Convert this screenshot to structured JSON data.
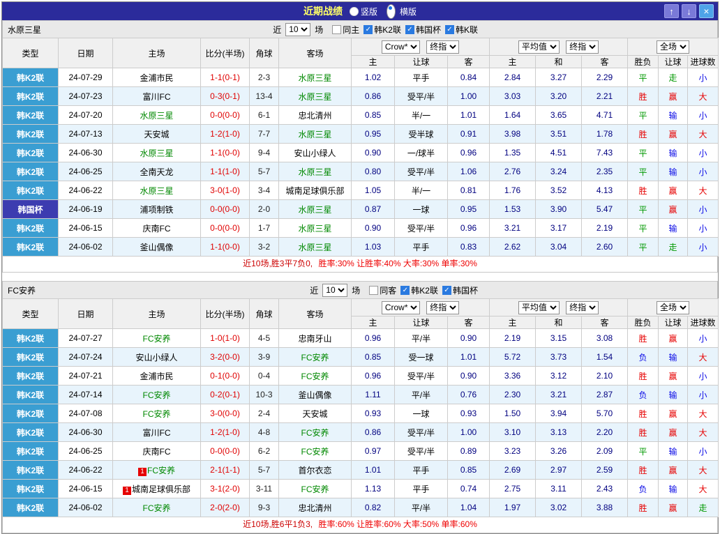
{
  "titlebar": {
    "title": "近期战绩",
    "radios": [
      {
        "label": "竖版",
        "selected": false
      },
      {
        "label": "横版",
        "selected": true
      }
    ],
    "buttons": {
      "up": "↑",
      "down": "↓",
      "close": "×"
    }
  },
  "table_headers": {
    "type": "类型",
    "date": "日期",
    "home": "主场",
    "score": "比分(半场)",
    "corner": "角球",
    "away": "客场",
    "sub": [
      "主",
      "让球",
      "客",
      "主",
      "和",
      "客",
      "胜负",
      "让球",
      "进球数"
    ]
  },
  "sections": [
    {
      "title": "水原三星",
      "filter": {
        "near": "近",
        "count": "10",
        "unit": "场",
        "checkboxes": [
          {
            "label": "同主",
            "checked": false
          },
          {
            "label": "韩K2联",
            "checked": true
          },
          {
            "label": "韩国杯",
            "checked": true
          },
          {
            "label": "韩K联",
            "checked": true
          }
        ]
      },
      "selects": {
        "g1a": "Crow*",
        "g1b": "终指",
        "g2a": "平均值",
        "g2b": "终指",
        "g3a": "全场"
      },
      "rows": [
        {
          "league": "韩K2联",
          "cup": false,
          "date": "24-07-29",
          "home": "金浦市民",
          "home_focus": false,
          "home_badge": "",
          "score": "1-1(0-1)",
          "corner": "2-3",
          "away": "水原三星",
          "away_focus": true,
          "away_badge": "",
          "ah": [
            "1.02",
            "平手",
            "0.84"
          ],
          "eu": [
            "2.84",
            "3.27",
            "2.29"
          ],
          "results": [
            {
              "t": "平",
              "c": "g"
            },
            {
              "t": "走",
              "c": "g"
            },
            {
              "t": "小",
              "c": "b"
            }
          ]
        },
        {
          "league": "韩K2联",
          "cup": false,
          "date": "24-07-23",
          "home": "富川FC",
          "home_focus": false,
          "home_badge": "",
          "score": "0-3(0-1)",
          "corner": "13-4",
          "away": "水原三星",
          "away_focus": true,
          "away_badge": "",
          "ah": [
            "0.86",
            "受平/半",
            "1.00"
          ],
          "eu": [
            "3.03",
            "3.20",
            "2.21"
          ],
          "results": [
            {
              "t": "胜",
              "c": "r"
            },
            {
              "t": "赢",
              "c": "r"
            },
            {
              "t": "大",
              "c": "r"
            }
          ]
        },
        {
          "league": "韩K2联",
          "cup": false,
          "date": "24-07-20",
          "home": "水原三星",
          "home_focus": true,
          "home_badge": "",
          "score": "0-0(0-0)",
          "corner": "6-1",
          "away": "忠北清州",
          "away_focus": false,
          "away_badge": "",
          "ah": [
            "0.85",
            "半/一",
            "1.01"
          ],
          "eu": [
            "1.64",
            "3.65",
            "4.71"
          ],
          "results": [
            {
              "t": "平",
              "c": "g"
            },
            {
              "t": "输",
              "c": "b"
            },
            {
              "t": "小",
              "c": "b"
            }
          ]
        },
        {
          "league": "韩K2联",
          "cup": false,
          "date": "24-07-13",
          "home": "天安城",
          "home_focus": false,
          "home_badge": "",
          "score": "1-2(1-0)",
          "corner": "7-7",
          "away": "水原三星",
          "away_focus": true,
          "away_badge": "",
          "ah": [
            "0.95",
            "受半球",
            "0.91"
          ],
          "eu": [
            "3.98",
            "3.51",
            "1.78"
          ],
          "results": [
            {
              "t": "胜",
              "c": "r"
            },
            {
              "t": "赢",
              "c": "r"
            },
            {
              "t": "大",
              "c": "r"
            }
          ]
        },
        {
          "league": "韩K2联",
          "cup": false,
          "date": "24-06-30",
          "home": "水原三星",
          "home_focus": true,
          "home_badge": "",
          "score": "1-1(0-0)",
          "corner": "9-4",
          "away": "安山小绿人",
          "away_focus": false,
          "away_badge": "",
          "ah": [
            "0.90",
            "一/球半",
            "0.96"
          ],
          "eu": [
            "1.35",
            "4.51",
            "7.43"
          ],
          "results": [
            {
              "t": "平",
              "c": "g"
            },
            {
              "t": "输",
              "c": "b"
            },
            {
              "t": "小",
              "c": "b"
            }
          ]
        },
        {
          "league": "韩K2联",
          "cup": false,
          "date": "24-06-25",
          "home": "全南天龙",
          "home_focus": false,
          "home_badge": "",
          "score": "1-1(1-0)",
          "corner": "5-7",
          "away": "水原三星",
          "away_focus": true,
          "away_badge": "",
          "ah": [
            "0.80",
            "受平/半",
            "1.06"
          ],
          "eu": [
            "2.76",
            "3.24",
            "2.35"
          ],
          "results": [
            {
              "t": "平",
              "c": "g"
            },
            {
              "t": "输",
              "c": "b"
            },
            {
              "t": "小",
              "c": "b"
            }
          ]
        },
        {
          "league": "韩K2联",
          "cup": false,
          "date": "24-06-22",
          "home": "水原三星",
          "home_focus": true,
          "home_badge": "",
          "score": "3-0(1-0)",
          "corner": "3-4",
          "away": "城南足球俱乐部",
          "away_focus": false,
          "away_badge": "",
          "ah": [
            "1.05",
            "半/一",
            "0.81"
          ],
          "eu": [
            "1.76",
            "3.52",
            "4.13"
          ],
          "results": [
            {
              "t": "胜",
              "c": "r"
            },
            {
              "t": "赢",
              "c": "r"
            },
            {
              "t": "大",
              "c": "r"
            }
          ]
        },
        {
          "league": "韩国杯",
          "cup": true,
          "date": "24-06-19",
          "home": "浦项制铁",
          "home_focus": false,
          "home_badge": "",
          "score": "0-0(0-0)",
          "corner": "2-0",
          "away": "水原三星",
          "away_focus": true,
          "away_badge": "",
          "ah": [
            "0.87",
            "一球",
            "0.95"
          ],
          "eu": [
            "1.53",
            "3.90",
            "5.47"
          ],
          "results": [
            {
              "t": "平",
              "c": "g"
            },
            {
              "t": "赢",
              "c": "r"
            },
            {
              "t": "小",
              "c": "b"
            }
          ]
        },
        {
          "league": "韩K2联",
          "cup": false,
          "date": "24-06-15",
          "home": "庆南FC",
          "home_focus": false,
          "home_badge": "",
          "score": "0-0(0-0)",
          "corner": "1-7",
          "away": "水原三星",
          "away_focus": true,
          "away_badge": "",
          "ah": [
            "0.90",
            "受平/半",
            "0.96"
          ],
          "eu": [
            "3.21",
            "3.17",
            "2.19"
          ],
          "results": [
            {
              "t": "平",
              "c": "g"
            },
            {
              "t": "输",
              "c": "b"
            },
            {
              "t": "小",
              "c": "b"
            }
          ]
        },
        {
          "league": "韩K2联",
          "cup": false,
          "date": "24-06-02",
          "home": "釜山偶像",
          "home_focus": false,
          "home_badge": "",
          "score": "1-1(0-0)",
          "corner": "3-2",
          "away": "水原三星",
          "away_focus": true,
          "away_badge": "",
          "ah": [
            "1.03",
            "平手",
            "0.83"
          ],
          "eu": [
            "2.62",
            "3.04",
            "2.60"
          ],
          "results": [
            {
              "t": "平",
              "c": "g"
            },
            {
              "t": "走",
              "c": "g"
            },
            {
              "t": "小",
              "c": "b"
            }
          ]
        }
      ],
      "summary": {
        "record": "近10场,胜3平7负0,",
        "stats": "胜率:30% 让胜率:40% 大率:30% 单率:30%"
      }
    },
    {
      "title": "FC安养",
      "filter": {
        "near": "近",
        "count": "10",
        "unit": "场",
        "checkboxes": [
          {
            "label": "同客",
            "checked": false
          },
          {
            "label": "韩K2联",
            "checked": true
          },
          {
            "label": "韩国杯",
            "checked": true
          }
        ]
      },
      "selects": {
        "g1a": "Crow*",
        "g1b": "终指",
        "g2a": "平均值",
        "g2b": "终指",
        "g3a": "全场"
      },
      "rows": [
        {
          "league": "韩K2联",
          "cup": false,
          "date": "24-07-27",
          "home": "FC安养",
          "home_focus": true,
          "home_badge": "",
          "score": "1-0(1-0)",
          "corner": "4-5",
          "away": "忠南牙山",
          "away_focus": false,
          "away_badge": "",
          "ah": [
            "0.96",
            "平/半",
            "0.90"
          ],
          "eu": [
            "2.19",
            "3.15",
            "3.08"
          ],
          "results": [
            {
              "t": "胜",
              "c": "r"
            },
            {
              "t": "赢",
              "c": "r"
            },
            {
              "t": "小",
              "c": "b"
            }
          ]
        },
        {
          "league": "韩K2联",
          "cup": false,
          "date": "24-07-24",
          "home": "安山小绿人",
          "home_focus": false,
          "home_badge": "",
          "score": "3-2(0-0)",
          "corner": "3-9",
          "away": "FC安养",
          "away_focus": true,
          "away_badge": "",
          "ah": [
            "0.85",
            "受一球",
            "1.01"
          ],
          "eu": [
            "5.72",
            "3.73",
            "1.54"
          ],
          "results": [
            {
              "t": "负",
              "c": "b"
            },
            {
              "t": "输",
              "c": "b"
            },
            {
              "t": "大",
              "c": "r"
            }
          ]
        },
        {
          "league": "韩K2联",
          "cup": false,
          "date": "24-07-21",
          "home": "金浦市民",
          "home_focus": false,
          "home_badge": "",
          "score": "0-1(0-0)",
          "corner": "0-4",
          "away": "FC安养",
          "away_focus": true,
          "away_badge": "",
          "ah": [
            "0.96",
            "受平/半",
            "0.90"
          ],
          "eu": [
            "3.36",
            "3.12",
            "2.10"
          ],
          "results": [
            {
              "t": "胜",
              "c": "r"
            },
            {
              "t": "赢",
              "c": "r"
            },
            {
              "t": "小",
              "c": "b"
            }
          ]
        },
        {
          "league": "韩K2联",
          "cup": false,
          "date": "24-07-14",
          "home": "FC安养",
          "home_focus": true,
          "home_badge": "",
          "score": "0-2(0-1)",
          "corner": "10-3",
          "away": "釜山偶像",
          "away_focus": false,
          "away_badge": "",
          "ah": [
            "1.11",
            "平/半",
            "0.76"
          ],
          "eu": [
            "2.30",
            "3.21",
            "2.87"
          ],
          "results": [
            {
              "t": "负",
              "c": "b"
            },
            {
              "t": "输",
              "c": "b"
            },
            {
              "t": "小",
              "c": "b"
            }
          ]
        },
        {
          "league": "韩K2联",
          "cup": false,
          "date": "24-07-08",
          "home": "FC安养",
          "home_focus": true,
          "home_badge": "",
          "score": "3-0(0-0)",
          "corner": "2-4",
          "away": "天安城",
          "away_focus": false,
          "away_badge": "",
          "ah": [
            "0.93",
            "一球",
            "0.93"
          ],
          "eu": [
            "1.50",
            "3.94",
            "5.70"
          ],
          "results": [
            {
              "t": "胜",
              "c": "r"
            },
            {
              "t": "赢",
              "c": "r"
            },
            {
              "t": "大",
              "c": "r"
            }
          ]
        },
        {
          "league": "韩K2联",
          "cup": false,
          "date": "24-06-30",
          "home": "富川FC",
          "home_focus": false,
          "home_badge": "",
          "score": "1-2(1-0)",
          "corner": "4-8",
          "away": "FC安养",
          "away_focus": true,
          "away_badge": "",
          "ah": [
            "0.86",
            "受平/半",
            "1.00"
          ],
          "eu": [
            "3.10",
            "3.13",
            "2.20"
          ],
          "results": [
            {
              "t": "胜",
              "c": "r"
            },
            {
              "t": "赢",
              "c": "r"
            },
            {
              "t": "大",
              "c": "r"
            }
          ]
        },
        {
          "league": "韩K2联",
          "cup": false,
          "date": "24-06-25",
          "home": "庆南FC",
          "home_focus": false,
          "home_badge": "",
          "score": "0-0(0-0)",
          "corner": "6-2",
          "away": "FC安养",
          "away_focus": true,
          "away_badge": "",
          "ah": [
            "0.97",
            "受平/半",
            "0.89"
          ],
          "eu": [
            "3.23",
            "3.26",
            "2.09"
          ],
          "results": [
            {
              "t": "平",
              "c": "g"
            },
            {
              "t": "输",
              "c": "b"
            },
            {
              "t": "小",
              "c": "b"
            }
          ]
        },
        {
          "league": "韩K2联",
          "cup": false,
          "date": "24-06-22",
          "home": "FC安养",
          "home_focus": true,
          "home_badge": "1",
          "score": "2-1(1-1)",
          "corner": "5-7",
          "away": "首尔衣恋",
          "away_focus": false,
          "away_badge": "",
          "ah": [
            "1.01",
            "平手",
            "0.85"
          ],
          "eu": [
            "2.69",
            "2.97",
            "2.59"
          ],
          "results": [
            {
              "t": "胜",
              "c": "r"
            },
            {
              "t": "赢",
              "c": "r"
            },
            {
              "t": "大",
              "c": "r"
            }
          ]
        },
        {
          "league": "韩K2联",
          "cup": false,
          "date": "24-06-15",
          "home": "城南足球俱乐部",
          "home_focus": false,
          "home_badge": "1",
          "score": "3-1(2-0)",
          "corner": "3-11",
          "away": "FC安养",
          "away_focus": true,
          "away_badge": "",
          "ah": [
            "1.13",
            "平手",
            "0.74"
          ],
          "eu": [
            "2.75",
            "3.11",
            "2.43"
          ],
          "results": [
            {
              "t": "负",
              "c": "b"
            },
            {
              "t": "输",
              "c": "b"
            },
            {
              "t": "大",
              "c": "r"
            }
          ]
        },
        {
          "league": "韩K2联",
          "cup": false,
          "date": "24-06-02",
          "home": "FC安养",
          "home_focus": true,
          "home_badge": "",
          "score": "2-0(2-0)",
          "corner": "9-3",
          "away": "忠北清州",
          "away_focus": false,
          "away_badge": "",
          "ah": [
            "0.82",
            "平/半",
            "1.04"
          ],
          "eu": [
            "1.97",
            "3.02",
            "3.88"
          ],
          "results": [
            {
              "t": "胜",
              "c": "r"
            },
            {
              "t": "赢",
              "c": "r"
            },
            {
              "t": "走",
              "c": "g"
            }
          ]
        }
      ],
      "summary": {
        "record": "近10场,胜6平1负3,",
        "stats": "胜率:60% 让胜率:60% 大率:50% 单率:60%"
      }
    }
  ]
}
